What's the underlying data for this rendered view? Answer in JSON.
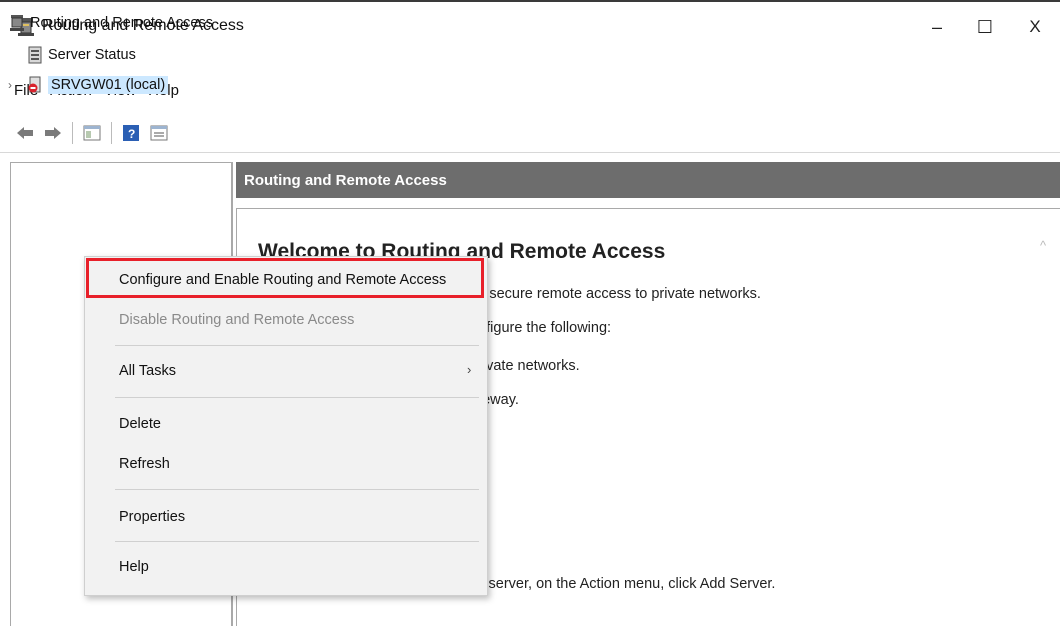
{
  "window": {
    "title": "Routing and Remote Access",
    "controls": {
      "minimize": "–",
      "maximize": "☐",
      "close": "X"
    }
  },
  "menubar": [
    "File",
    "Action",
    "View",
    "Help"
  ],
  "toolbar": {
    "icons": [
      "back-arrow-icon",
      "forward-arrow-icon",
      "console-tree-icon",
      "help-icon",
      "properties-icon"
    ]
  },
  "tree": {
    "root": "Routing and Remote Access",
    "server_status": "Server Status",
    "server": "SRVGW01 (local)",
    "expander": "›"
  },
  "right_pane": {
    "header": "Routing and Remote Access",
    "welcome_title": "Welcome to Routing and Remote Access",
    "lines": [
      "es secure remote access to private networks.",
      "onfigure the following:",
      "private networks.",
      "ateway.",
      ").",
      "ss server, on the Action menu, click Add Server."
    ],
    "scroll_up": "^"
  },
  "context_menu": {
    "items": {
      "configure": "Configure and Enable Routing and Remote Access",
      "disable": "Disable Routing and Remote Access",
      "all_tasks": "All Tasks",
      "delete": "Delete",
      "refresh": "Refresh",
      "properties": "Properties",
      "help": "Help"
    },
    "submenu_arrow": "›"
  },
  "colors": {
    "highlight": "#e8202a",
    "header_bg": "#6d6d6d",
    "selection": "#cce8ff"
  }
}
